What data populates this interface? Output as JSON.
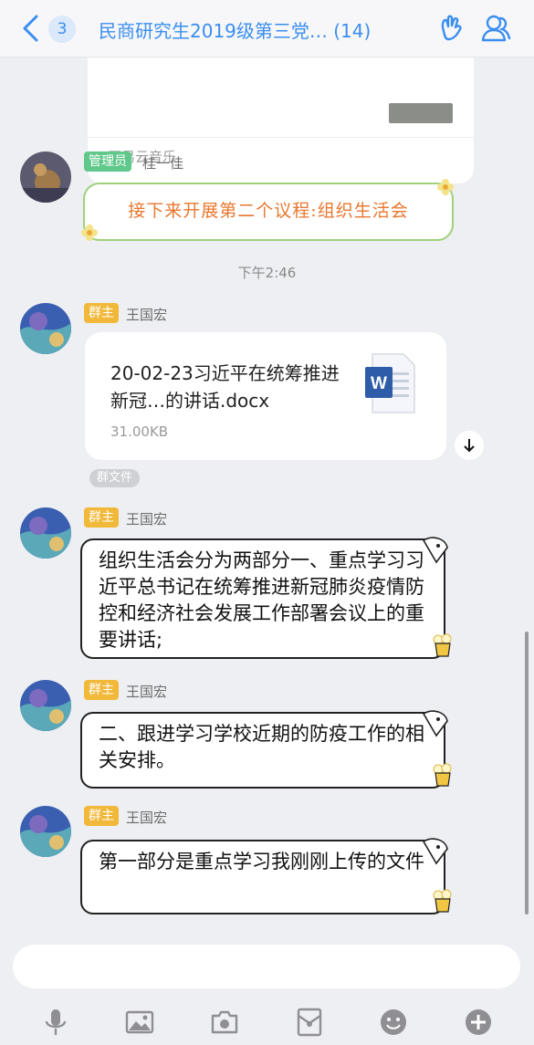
{
  "header": {
    "back_count": "3",
    "title": "民商研究生2019级第三党… (14)"
  },
  "music_card": {
    "source": "网易云音乐"
  },
  "messages": [
    {
      "role": "管理员",
      "sender": "桂一佳",
      "text": "接下来开展第二个议程:组织生活会"
    },
    {
      "time": "下午2:46"
    },
    {
      "role": "群主",
      "sender": "王国宏",
      "file_name": "20-02-23习近平在统筹推进新冠…的讲话.docx",
      "file_size": "31.00KB",
      "tag": "群文件"
    },
    {
      "role": "群主",
      "sender": "王国宏",
      "text": "组织生活会分为两部分一、重点学习习近平总书记在统筹推进新冠肺炎疫情防控和经济社会发展工作部署会议上的重要讲话;"
    },
    {
      "role": "群主",
      "sender": "王国宏",
      "text": "二、跟进学习学校近期的防疫工作的相关安排。"
    },
    {
      "role": "群主",
      "sender": "王国宏",
      "text": "第一部分是重点学习我刚刚上传的文件"
    }
  ],
  "colors": {
    "accent": "#3a8ef0",
    "admin_badge": "#5fc88a",
    "owner_badge": "#f1b83a",
    "highlight_text": "#e8772e"
  },
  "toolbar": {
    "icons": [
      "microphone-icon",
      "image-icon",
      "camera-icon",
      "red-packet-icon",
      "emoji-icon",
      "plus-icon"
    ]
  }
}
